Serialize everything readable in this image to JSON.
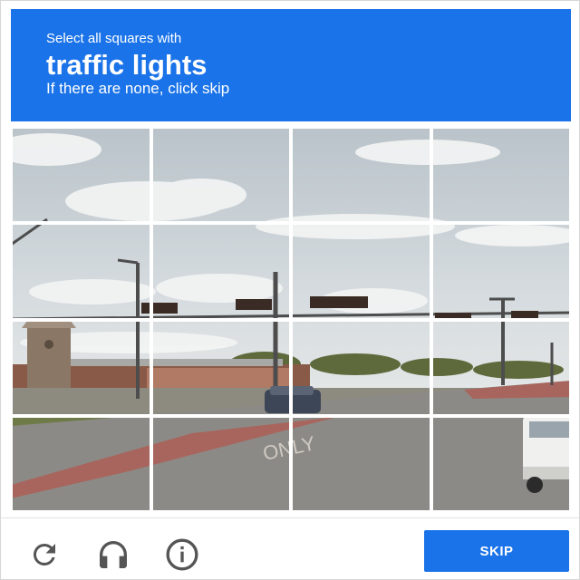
{
  "header": {
    "instruction": "Select all squares with",
    "target": "traffic lights",
    "hint": "If there are none, click skip"
  },
  "grid": {
    "rows": 4,
    "cols": 4,
    "scene": "street with traffic lights, clouds, road and pickup truck"
  },
  "road_marking": "ONLY",
  "footer": {
    "reload_icon": "reload-icon",
    "audio_icon": "headphones-icon",
    "info_icon": "info-icon",
    "skip_label": "SKIP"
  },
  "colors": {
    "accent": "#1a73e8",
    "sky": "#c9d1d6",
    "road": "#8c8a86"
  }
}
